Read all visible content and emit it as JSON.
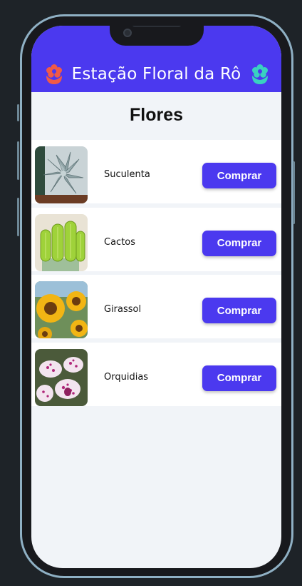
{
  "app": {
    "title": "Estação Floral da Rô",
    "left_icon": "flower-icon",
    "right_icon": "flower-icon",
    "left_icon_color": "#f05a47",
    "right_icon_color": "#39d2c0",
    "accent_color": "#4b39ef"
  },
  "page": {
    "title": "Flores"
  },
  "products": [
    {
      "name": "Suculenta",
      "button_label": "Comprar",
      "image": "succulent-photo"
    },
    {
      "name": "Cactos",
      "button_label": "Comprar",
      "image": "cactus-photo"
    },
    {
      "name": "Girassol",
      "button_label": "Comprar",
      "image": "sunflower-photo"
    },
    {
      "name": "Orquidias",
      "button_label": "Comprar",
      "image": "orchid-photo"
    }
  ]
}
